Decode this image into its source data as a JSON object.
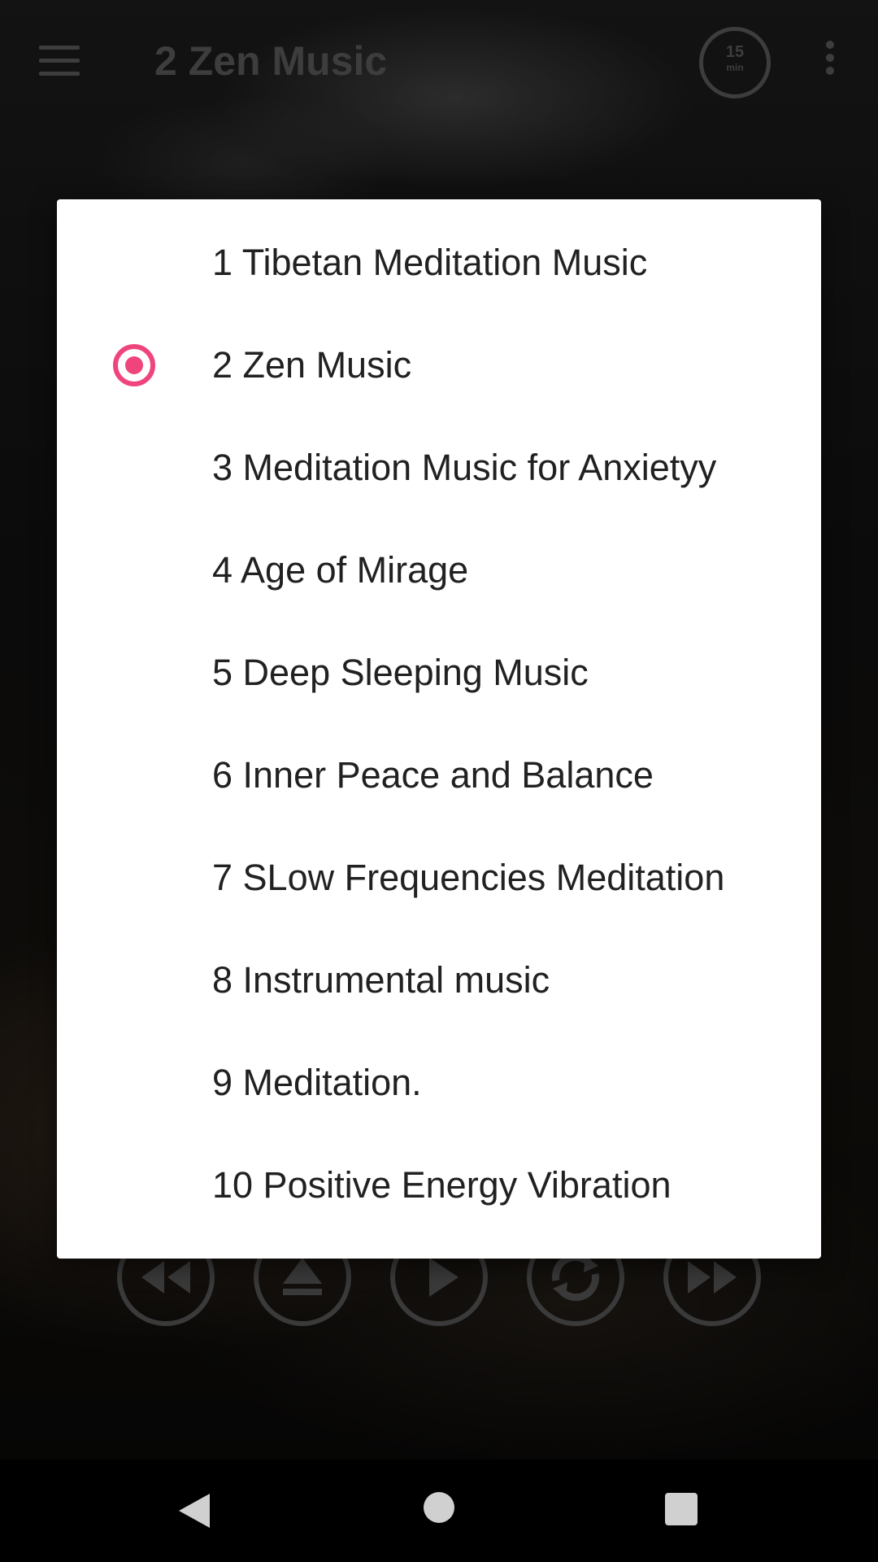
{
  "appbar": {
    "title": "2 Zen Music",
    "timer": {
      "value": "15",
      "unit": "min"
    },
    "icons": [
      "menu-icon",
      "timer-icon",
      "overflow-menu-icon"
    ]
  },
  "dialog": {
    "selected_index": 1,
    "accent_color": "#f0457c",
    "options": [
      {
        "label": "1 Tibetan Meditation Music"
      },
      {
        "label": "2 Zen Music"
      },
      {
        "label": "3 Meditation Music for Anxietyy"
      },
      {
        "label": "4 Age of Mirage"
      },
      {
        "label": "5 Deep Sleeping Music"
      },
      {
        "label": "6 Inner Peace and Balance"
      },
      {
        "label": "7 SLow Frequencies Meditation"
      },
      {
        "label": "8 Instrumental music"
      },
      {
        "label": "9 Meditation."
      },
      {
        "label": "10 Positive Energy Vibration"
      }
    ]
  },
  "player_controls": [
    "rewind-icon",
    "eject-icon",
    "play-icon",
    "repeat-icon",
    "fast-forward-icon"
  ],
  "navbar": [
    "back-icon",
    "home-icon",
    "recents-icon"
  ]
}
